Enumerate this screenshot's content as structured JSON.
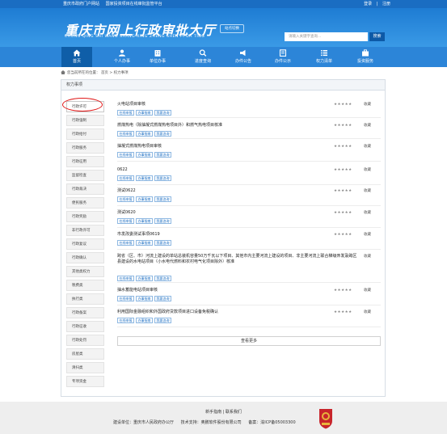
{
  "topbar": {
    "portal": "重庆市政府门户网站",
    "platform": "国家投资项目在线审批监管平台",
    "login": "登录",
    "register": "注册"
  },
  "header": {
    "logo": "重庆市网上行政审批大厅",
    "logo_pinyin": "CHONG QING SHI WANG SHANG XING ZHENG SHEN PI DA TING",
    "wechat_label": "站点切换"
  },
  "search": {
    "placeholder": "请输入关键字查询...",
    "button": "搜索"
  },
  "nav": {
    "items": [
      {
        "label": "首页",
        "icon": "home-icon"
      },
      {
        "label": "个人办事",
        "icon": "user-icon"
      },
      {
        "label": "单位办事",
        "icon": "building-icon"
      },
      {
        "label": "进度查询",
        "icon": "search-icon"
      },
      {
        "label": "办件公告",
        "icon": "notice-icon"
      },
      {
        "label": "办件公示",
        "icon": "publicity-icon"
      },
      {
        "label": "权力清单",
        "icon": "list-icon"
      },
      {
        "label": "投资服务",
        "icon": "briefcase-icon"
      }
    ]
  },
  "breadcrumb": {
    "prefix": "您当前所在的位置：",
    "home": "首页",
    "sep": ">",
    "current": "权力事项"
  },
  "panel": {
    "title": "权力事项"
  },
  "sidebar": {
    "items": [
      "行政许可",
      "行政强制",
      "行政给付",
      "行政服务",
      "行政征用",
      "监督检查",
      "行政裁决",
      "便民服务",
      "行政奖励",
      "非行政许可",
      "行政复议",
      "行政确认",
      "其他类权力",
      "税费类",
      "执行类",
      "行政备案",
      "行政征收",
      "行政处罚",
      "房屋类",
      "清扫类",
      "专项资金"
    ]
  },
  "list": {
    "items": [
      {
        "title": "火电站项目审核",
        "tags": [
          "在线申报",
          "办事指南",
          "我要咨询"
        ],
        "stars": "★★★★★",
        "fav": "收藏"
      },
      {
        "title": "燃煤热电（除抽凝式燃煤热电项目外）和燃气热电项目核准",
        "tags": [
          "在线申报",
          "办事指南",
          "我要咨询"
        ],
        "stars": "★★★★★",
        "fav": "收藏"
      },
      {
        "title": "抽凝式燃煤热电项目审核",
        "tags": [
          "在线申报",
          "办事指南",
          "我要咨询"
        ],
        "stars": "★★★★★",
        "fav": "收藏"
      },
      {
        "title": "0622",
        "tags": [
          "在线申报",
          "办事指南",
          "我要咨询"
        ],
        "stars": "★★★★★",
        "fav": "收藏"
      },
      {
        "title": "测试0622",
        "tags": [
          "在线申报",
          "办事指南",
          "我要咨询"
        ],
        "stars": "★★★★★",
        "fav": "收藏"
      },
      {
        "title": "测试0620",
        "tags": [
          "在线申报",
          "办事指南",
          "我要咨询"
        ],
        "stars": "★★★★★",
        "fav": "收藏"
      },
      {
        "title": "市发改委测试事项0619",
        "tags": [
          "在线申报",
          "办事指南",
          "我要咨询"
        ],
        "stars": "★★★★★",
        "fav": "收藏"
      },
      {
        "title": "跨省（区、市）河流上建设的单站总装机容量50万千瓦以下项目、其他市内主要河流上建设的项目、非主要河流上联合梯级开发及跨区县建设的水电站项目（小水电代燃料和农村电气化项目除外）核准",
        "tags": [
          "在线申报",
          "办事指南",
          "我要咨询"
        ],
        "stars": "★★★★★",
        "fav": "收藏"
      },
      {
        "title": "抽水蓄能电站项目审核",
        "tags": [
          "在线申报",
          "办事指南",
          "我要咨询"
        ],
        "stars": "★★★★★",
        "fav": "收藏"
      },
      {
        "title": "利用国际金融组织和外国政府贷款项目进口设备免税确认",
        "tags": [
          "在线申报",
          "办事指南",
          "我要咨询"
        ],
        "stars": "★★★★★",
        "fav": "收藏"
      }
    ]
  },
  "more_button": "查看更多",
  "footer": {
    "links": "新手指南 | 联系我们",
    "builder": "建设单位：重庆市人民政府办公厅",
    "support": "技术支持：奥鹏软件股份有限公司",
    "icp": "备案：渝ICP备05003300"
  },
  "colors": {
    "header": "#1e7cd3",
    "nav": "#2c85d8",
    "nav_active": "#0f5ea8",
    "highlight": "#e01919"
  }
}
